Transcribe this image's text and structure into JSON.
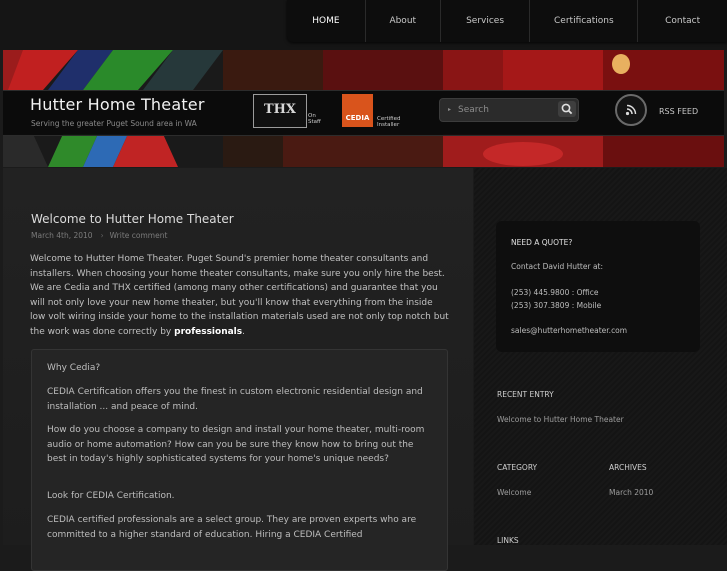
{
  "nav": {
    "items": [
      {
        "label": "HOME",
        "active": true
      },
      {
        "label": "About",
        "active": false
      },
      {
        "label": "Services",
        "active": false
      },
      {
        "label": "Certifications",
        "active": false
      },
      {
        "label": "Contact",
        "active": false
      }
    ]
  },
  "header": {
    "title": "Hutter Home Theater",
    "tagline": "Serving the greater Puget Sound area in WA",
    "thx": {
      "logo_text": "THX",
      "note_line1": "On",
      "note_line2": "Staff"
    },
    "cedia": {
      "logo_text": "CEDIA",
      "note_line1": "Certified",
      "note_line2": "Installer",
      "color": "#d9541c"
    },
    "search": {
      "placeholder": "Search"
    },
    "rss_label": "RSS FEED"
  },
  "post": {
    "title": "Welcome to Hutter Home Theater",
    "date": "March 4th, 2010",
    "comment_link": "Write comment",
    "intro_text": "Welcome to Hutter Home Theater. Puget Sound's premier home theater consultants and installers. When choosing your home theater consultants, make sure you only hire the best.  We are Cedia and THX certified (among many other certifications) and guarantee that you will not only love your new home theater, but you'll know that everything from the inside low volt wiring inside your home to the installation materials used are not only top notch but the work was done correctly by ",
    "intro_bold": "professionals",
    "intro_end": ".",
    "quote": {
      "heading": "Why Cedia?",
      "p1": "CEDIA Certification offers you the finest in custom electronic residential design and installation ... and peace of mind.",
      "p2": "How do you choose a company to design and install your home theater, multi-room audio or home automation? How can you be sure they know how to bring out the best in today's highly sophisticated systems for your home's unique needs?",
      "p3": "Look for CEDIA Certification.",
      "p4": "CEDIA certified professionals are a select group. They are proven experts who are committed to a higher standard of education. Hiring a CEDIA Certified"
    }
  },
  "sidebar": {
    "quote_box": {
      "title": "NEED A QUOTE?",
      "contact": "Contact David Hutter at:",
      "phone_office": "(253) 445.9800 : Office",
      "phone_mobile": "(253) 307.3809 : Mobile",
      "email": "sales@hutterhometheater.com"
    },
    "recent_heading": "RECENT ENTRY",
    "recent_link": "Welcome to Hutter Home Theater",
    "category_heading": "CATEGORY",
    "category_link": "Welcome",
    "archives_heading": "ARCHIVES",
    "archives_link": "March 2010",
    "links_heading": "LINKS"
  }
}
